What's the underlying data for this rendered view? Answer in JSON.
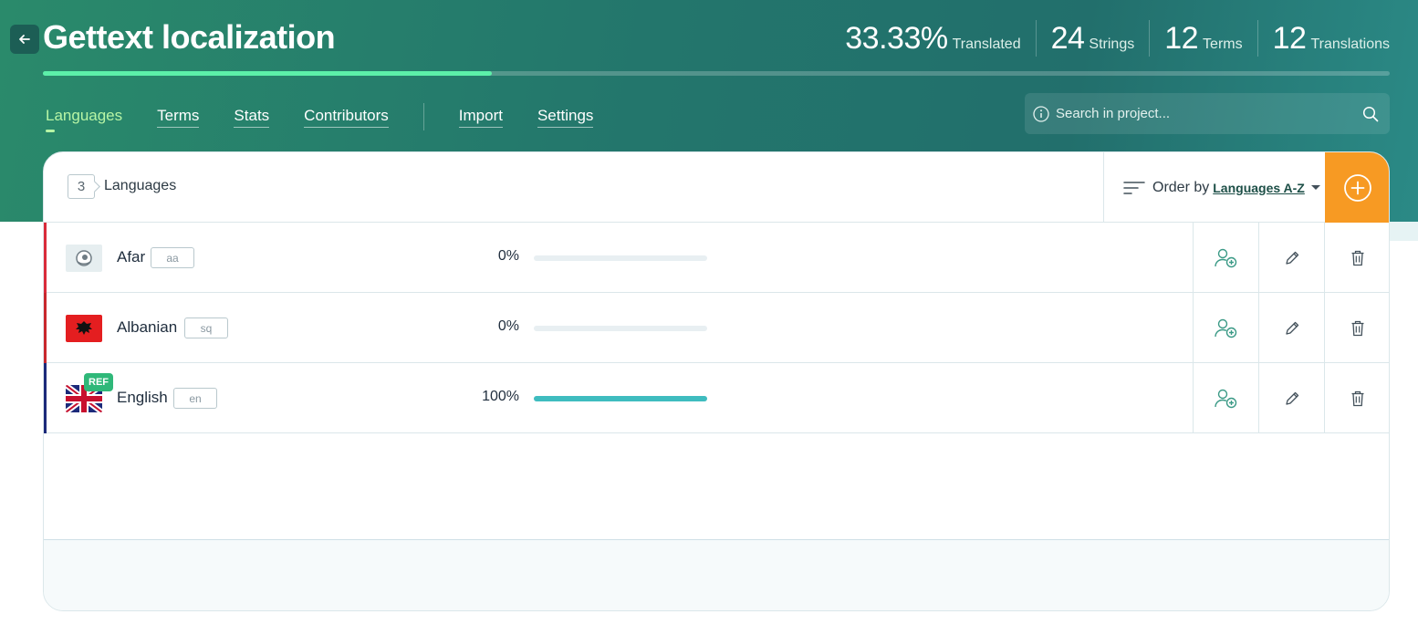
{
  "header": {
    "title": "Gettext localization",
    "back_icon": "arrow-left-icon",
    "stats": [
      {
        "value": "33.33%",
        "label": "Translated"
      },
      {
        "value": "24",
        "label": "Strings"
      },
      {
        "value": "12",
        "label": "Terms"
      },
      {
        "value": "12",
        "label": "Translations"
      }
    ],
    "progress_fraction": 0.3333,
    "progress_color": "#5cf0a9"
  },
  "tabs": [
    {
      "label": "Languages",
      "active": true
    },
    {
      "label": "Terms",
      "active": false
    },
    {
      "label": "Stats",
      "active": false
    },
    {
      "label": "Contributors",
      "active": false
    },
    {
      "label": "Import",
      "active": false
    },
    {
      "label": "Settings",
      "active": false
    }
  ],
  "search": {
    "placeholder": "Search in project..."
  },
  "list": {
    "count": "3",
    "count_label": "Languages",
    "order_label": "Order by",
    "order_value": "Languages A-Z",
    "add_color": "#f79a23"
  },
  "languages": [
    {
      "name": "Afar",
      "code": "aa",
      "percent": "0%",
      "progress": 0,
      "flag": "afar-flag",
      "accent": "#d92b3a",
      "ref": false
    },
    {
      "name": "Albanian",
      "code": "sq",
      "percent": "0%",
      "progress": 0,
      "flag": "albania-flag",
      "accent": "#c8272d",
      "ref": false
    },
    {
      "name": "English",
      "code": "en",
      "percent": "100%",
      "progress": 1,
      "flag": "uk-flag",
      "accent": "#1c2a7a",
      "ref": true,
      "ref_label": "REF"
    }
  ],
  "row_actions": [
    "add-contributor-icon",
    "edit-icon",
    "delete-icon"
  ],
  "colors": {
    "accent_teal": "#3fbcbf",
    "header_green": "#23766c"
  }
}
